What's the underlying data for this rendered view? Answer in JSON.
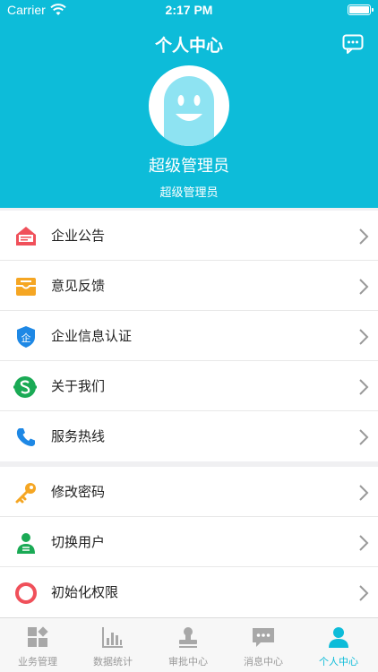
{
  "status_bar": {
    "carrier": "Carrier",
    "time": "2:17 PM"
  },
  "header": {
    "title": "个人中心",
    "message_icon": "chat-bubble-icon"
  },
  "profile": {
    "name": "超级管理员",
    "role": "超级管理员"
  },
  "menu_group_1": [
    {
      "label": "企业公告",
      "icon": "announcement-icon",
      "color": "#f0505a"
    },
    {
      "label": "意见反馈",
      "icon": "feedback-icon",
      "color": "#f5a623"
    },
    {
      "label": "企业信息认证",
      "icon": "certification-shield-icon",
      "color": "#1e88e5"
    },
    {
      "label": "关于我们",
      "icon": "about-logo-icon",
      "color": "#1aaa55"
    },
    {
      "label": "服务热线",
      "icon": "phone-icon",
      "color": "#1e88e5"
    }
  ],
  "menu_group_2": [
    {
      "label": "修改密码",
      "icon": "key-icon",
      "color": "#f5a623"
    },
    {
      "label": "切换用户",
      "icon": "switch-user-icon",
      "color": "#1aaa55"
    },
    {
      "label": "初始化权限",
      "icon": "reset-ring-icon",
      "color": "#f0505a"
    }
  ],
  "tabbar": [
    {
      "label": "业务管理",
      "icon": "business-grid-icon",
      "active": false
    },
    {
      "label": "数据统计",
      "icon": "bar-chart-icon",
      "active": false
    },
    {
      "label": "审批中心",
      "icon": "approval-stamp-icon",
      "active": false
    },
    {
      "label": "消息中心",
      "icon": "message-icon",
      "active": false
    },
    {
      "label": "个人中心",
      "icon": "person-icon",
      "active": true
    }
  ],
  "colors": {
    "accent": "#0dbcd9",
    "inactive_tab": "#999999"
  }
}
